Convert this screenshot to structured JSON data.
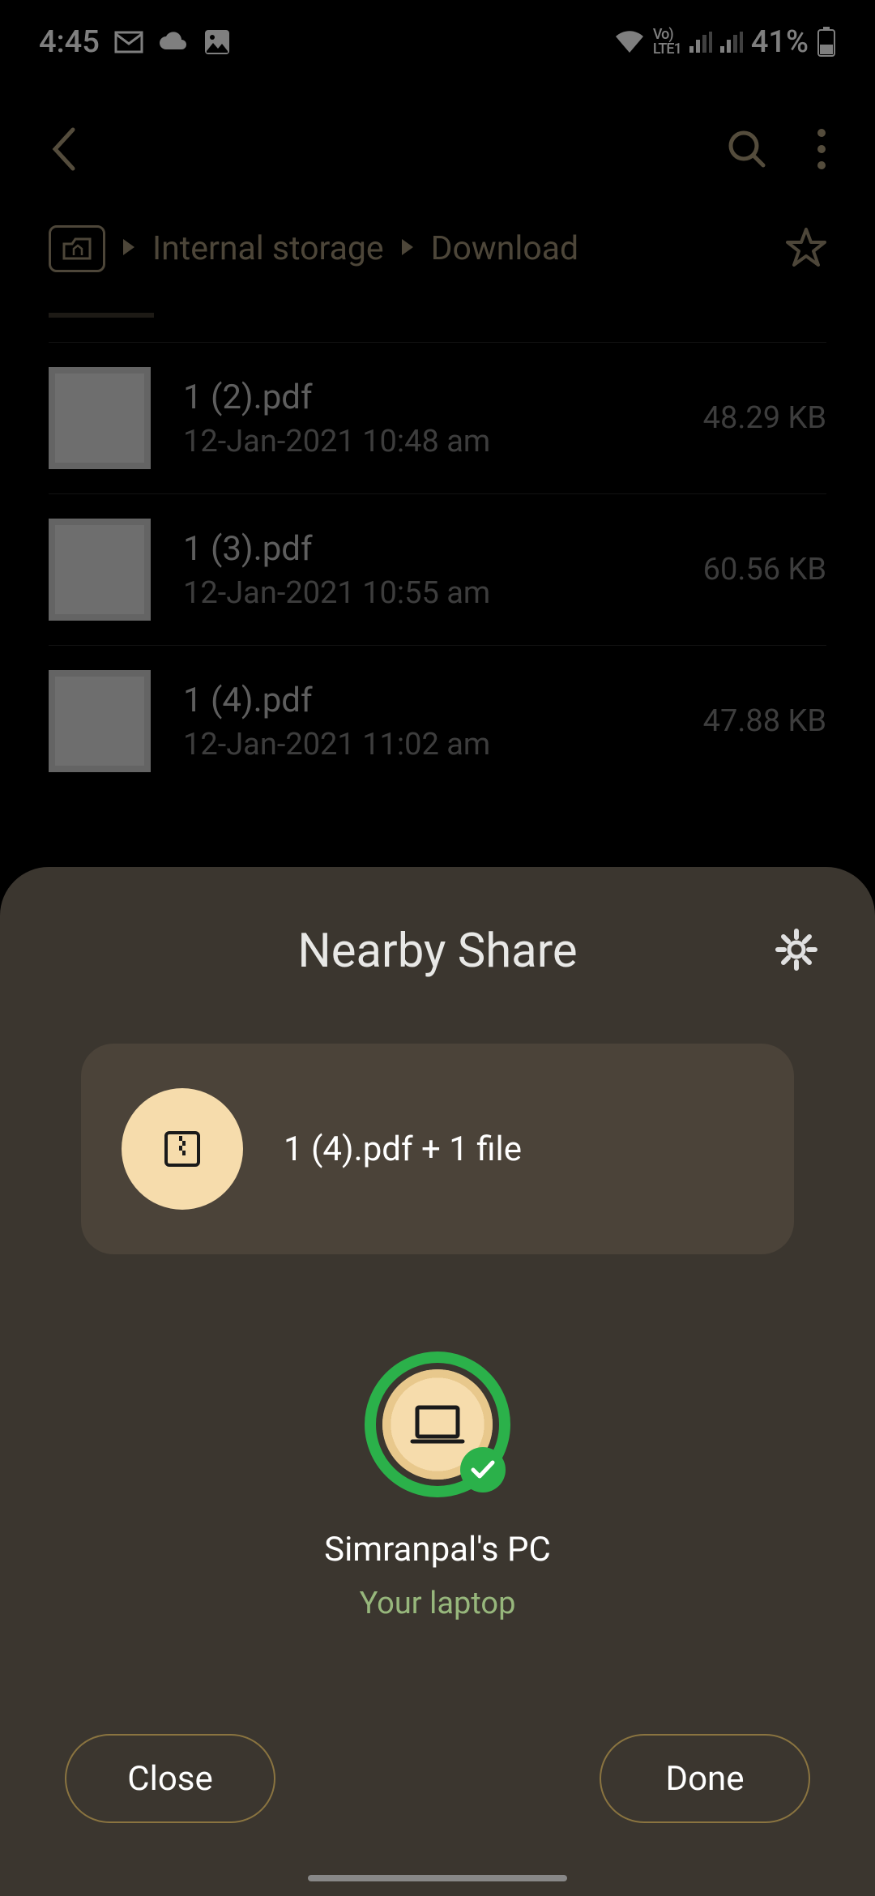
{
  "status": {
    "time": "4:45",
    "battery": "41%"
  },
  "breadcrumb": {
    "items": [
      "Internal storage",
      "Download"
    ]
  },
  "files": [
    {
      "name": "1 (2).pdf",
      "date": "12-Jan-2021 10:48 am",
      "size": "48.29 KB"
    },
    {
      "name": "1 (3).pdf",
      "date": "12-Jan-2021 10:55 am",
      "size": "60.56 KB"
    },
    {
      "name": "1 (4).pdf",
      "date": "12-Jan-2021 11:02 am",
      "size": "47.88 KB"
    }
  ],
  "sheet": {
    "title": "Nearby Share",
    "payload": "1 (4).pdf + 1 file",
    "device": {
      "name": "Simranpal's PC",
      "sub": "Your laptop"
    },
    "close": "Close",
    "done": "Done"
  }
}
